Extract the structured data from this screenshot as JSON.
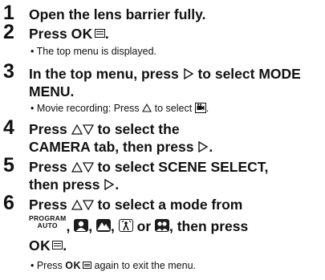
{
  "steps": [
    {
      "num": "1",
      "text": "Open the lens barrier fully."
    },
    {
      "num": "2",
      "text": "Press",
      "ok": "OK",
      "end": "."
    },
    {
      "num": "3",
      "line1": "In the top menu, press",
      "line1b": "to select MODE",
      "line2": "MENU."
    },
    {
      "num": "4",
      "line1": "Press",
      "line1b": "to select the",
      "line2a": "CAMERA tab, then press",
      "line2b": "."
    },
    {
      "num": "5",
      "line1": "Press",
      "line1b": "to select SCENE SELECT,",
      "line2a": "then press",
      "line2b": "."
    },
    {
      "num": "6",
      "line1": "Press",
      "line1b": "to select a mode from",
      "line2_comma1": ",",
      "line2_comma2": ",",
      "line2_comma3": ",",
      "line2_or": "or",
      "line2_end": ", then press",
      "line3_ok": "OK",
      "line3_end": "."
    }
  ],
  "subs": {
    "s2": "• The top menu is displayed.",
    "s3a": "• Movie recording: Press",
    "s3b": "to select",
    "s3c": ".",
    "s6a": "• Press",
    "s6ok": "OK",
    "s6b": "again to exit the menu."
  },
  "program_auto": {
    "top": "PROGRAM",
    "bottom": "AUTO"
  },
  "icons": [
    "menu-icon",
    "right-triangle-icon",
    "up-triangle-icon",
    "down-triangle-icon",
    "movie-mode-icon",
    "portrait-scene-icon",
    "landscape-scene-icon",
    "night-scene-icon",
    "self-portrait-scene-icon"
  ]
}
